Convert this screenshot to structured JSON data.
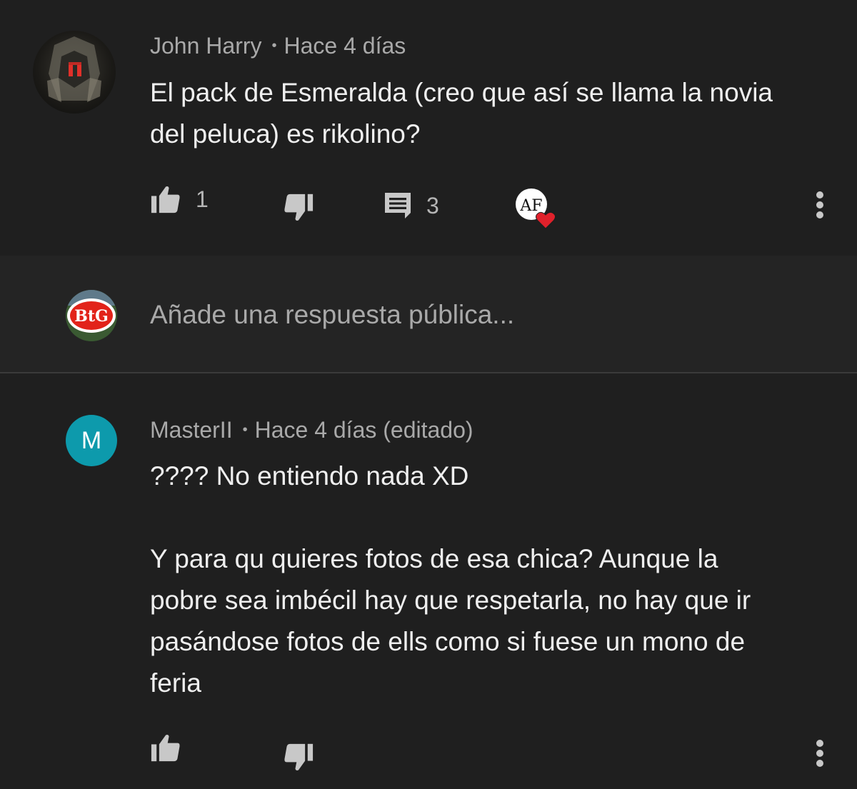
{
  "comment1": {
    "author": "John Harry",
    "time": "Hace 4 días",
    "text_line1": "El pack de Esmeralda (creo que así se llama la novia",
    "text_line2": "del peluca) es rikolino?",
    "like_count": "1",
    "reply_count": "3",
    "creator_heart_initials": "AF"
  },
  "reply_box": {
    "avatar_label": "BtG",
    "placeholder": "Añade una respuesta pública..."
  },
  "comment2": {
    "author": "MasterII",
    "avatar_letter": "M",
    "time": "Hace 4 días (editado)",
    "line1": "???? No entiendo nada XD",
    "line2": "Y para qu quieres fotos de esa chica? Aunque la",
    "line3": "pobre sea imbécil hay que respetarla, no hay que ir",
    "line4": "pasándose fotos de ells como si fuese un mono de",
    "line5": "feria"
  },
  "icons": [
    "thumbs-up-icon",
    "thumbs-down-icon",
    "comment-icon",
    "heart-icon",
    "more-vert-icon"
  ],
  "colors": {
    "background": "#1f1f1f",
    "avatar_m": "#0d9aac",
    "heart": "#e0212b"
  }
}
